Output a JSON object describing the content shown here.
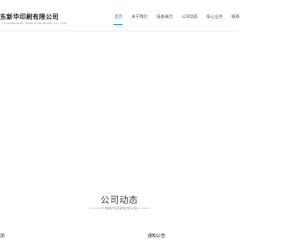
{
  "header": {
    "company_name": "东新华印刷有限公司",
    "company_subtitle": "GUANGDONG XINHUA PRINTING CO., LTD."
  },
  "nav": {
    "items": [
      {
        "label": "首页"
      },
      {
        "label": "关于我们"
      },
      {
        "label": "设备展示"
      },
      {
        "label": "公司动态"
      },
      {
        "label": "核心业务"
      },
      {
        "label": "联系"
      }
    ]
  },
  "section": {
    "title": "公司动态",
    "subtitle": "广东新华印刷有限公司"
  },
  "columns": {
    "left_heading": "加",
    "right_heading": "通知公告"
  },
  "colors": {
    "accent": "#1e8fd8"
  }
}
